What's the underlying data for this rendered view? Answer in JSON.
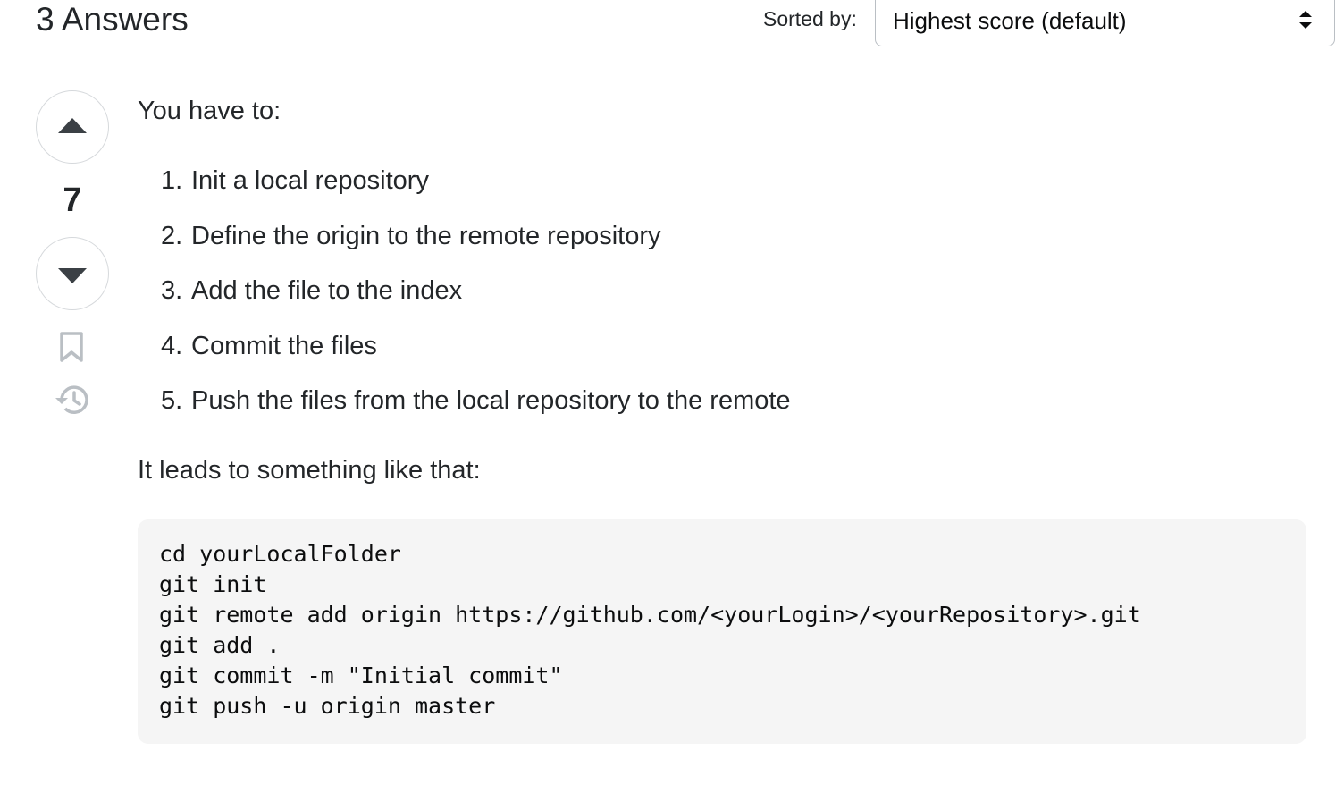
{
  "header": {
    "answers_count": "3 Answers",
    "sort_label": "Sorted by:",
    "sort_value": "Highest score (default)"
  },
  "vote": {
    "count": "7",
    "upvote_icon": "caret-up-icon",
    "downvote_icon": "caret-down-icon",
    "bookmark_icon": "bookmark-icon",
    "history_icon": "history-icon"
  },
  "answer": {
    "intro": "You have to:",
    "steps": [
      {
        "num": "1.",
        "text": "Init a local repository"
      },
      {
        "num": "2.",
        "text": "Define the origin to the remote repository"
      },
      {
        "num": "3.",
        "text": "Add the file to the index"
      },
      {
        "num": "4.",
        "text": "Commit the files"
      },
      {
        "num": "5.",
        "text": "Push the files from the local repository to the remote"
      }
    ],
    "lead": "It leads to something like that:",
    "code": [
      "cd yourLocalFolder",
      "git init",
      "git remote add origin https://github.com/<yourLogin>/<yourRepository>.git",
      "git add .",
      "git commit -m \"Initial commit\"",
      "git push -u origin master"
    ]
  },
  "colors": {
    "text": "#232629",
    "icon": "#3b4045",
    "muted_icon": "#babfc4",
    "code_bg": "#f5f5f5",
    "border": "#d6d9dc"
  }
}
